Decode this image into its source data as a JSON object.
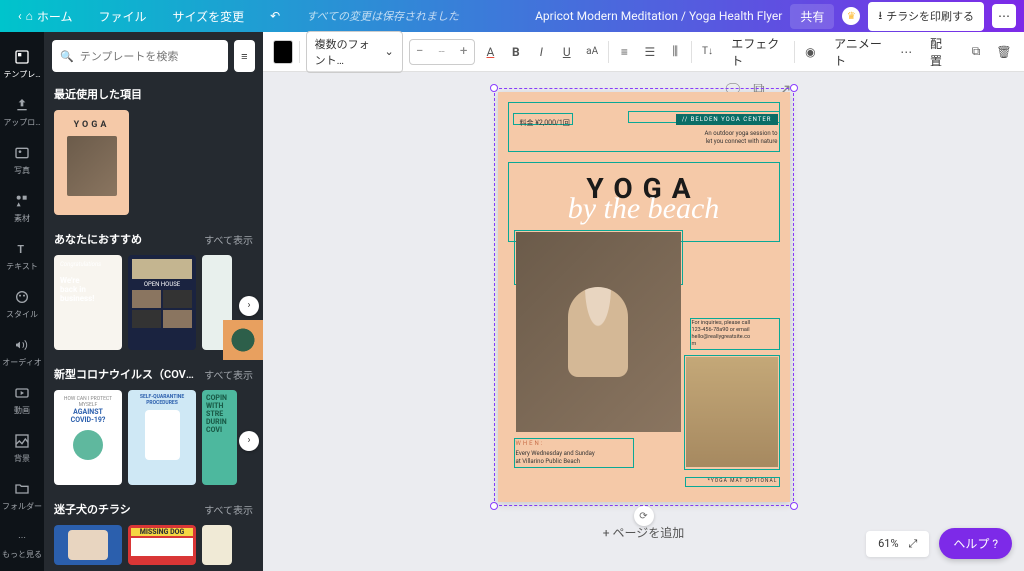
{
  "topbar": {
    "home": "ホーム",
    "file": "ファイル",
    "resize": "サイズを変更",
    "status": "すべての変更は保存されました",
    "doc_title": "Apricot Modern Meditation / Yoga Health Flyer",
    "share": "共有",
    "print": "チラシを印刷する"
  },
  "rail": {
    "template": "テンプレ…",
    "upload": "アップロ…",
    "photo": "写真",
    "elements": "素材",
    "text": "テキスト",
    "style": "スタイル",
    "audio": "オーディオ",
    "video": "動画",
    "background": "背景",
    "folder": "フォルダー",
    "more": "もっと見る"
  },
  "panel": {
    "search_placeholder": "テンプレートを検索",
    "recent": "最近使用した項目",
    "recommend": "あなたにおすすめ",
    "covid": "新型コロナウイルス（COVID-19）関…",
    "lost_dog": "迷子犬のチラシ",
    "show_all": "すべて表示",
    "rec1_line1": "We're",
    "rec1_line2": "back in",
    "rec1_line3": "business!",
    "rec2_title": "OPEN HOUSE",
    "covid1_a": "AGAINST",
    "covid1_b": "COVID-19?",
    "covid2_a": "SELF-QUARANTINE",
    "covid2_b": "PROCEDURES",
    "covid3_a": "COPIN",
    "covid3_b": "WITH",
    "covid3_c": "STRE",
    "covid3_d": "DURIN",
    "covid3_e": "COVI",
    "dog_title": "MISSING DOG"
  },
  "toolbar": {
    "font": "複数のフォント…",
    "size": "--",
    "effect": "エフェクト",
    "animate": "アニメート",
    "position": "配置"
  },
  "flyer": {
    "price": "料金 ¥2,000/1回",
    "center": "// BELDEN YOGA CENTER",
    "tagline1": "An outdoor yoga session to",
    "tagline2": "let you connect with nature",
    "yoga": "YOGA",
    "script": "by the beach",
    "inquiry1": "For inquiries, please call",
    "inquiry2": "123-456-78a90 or email",
    "inquiry3": "hello@reallygreatsite.co",
    "inquiry4": "m",
    "when_label": "WHEN:",
    "when1": "Every Wednesday and Sunday",
    "when2": "at Villarino Public Beach",
    "mat": "*YOGA MAT OPTIONAL"
  },
  "canvas": {
    "add_page": "+ ページを追加",
    "zoom": "61%",
    "help": "ヘルプ ?"
  }
}
